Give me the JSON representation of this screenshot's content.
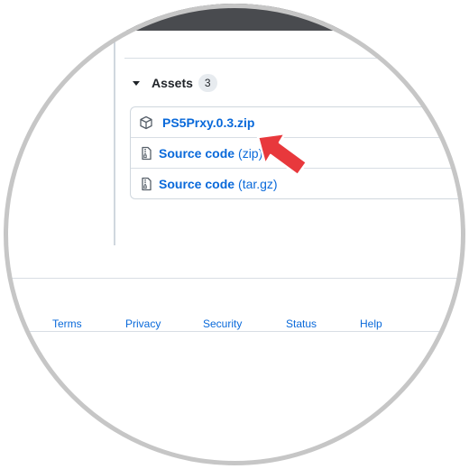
{
  "assets": {
    "title": "Assets",
    "count": "3",
    "items": [
      {
        "name": "PS5Prxy.0.3.zip",
        "suffix": "",
        "icon": "package-icon"
      },
      {
        "name": "Source code",
        "suffix": "(zip)",
        "icon": "file-zip-icon"
      },
      {
        "name": "Source code",
        "suffix": "(tar.gz)",
        "icon": "file-zip-icon"
      }
    ]
  },
  "footer": {
    "links": [
      "Terms",
      "Privacy",
      "Security",
      "Status",
      "Help"
    ]
  },
  "colors": {
    "link": "#0969da",
    "arrow": "#e8383c",
    "top_bar": "#494b4f",
    "ring": "#c6c6c6"
  }
}
